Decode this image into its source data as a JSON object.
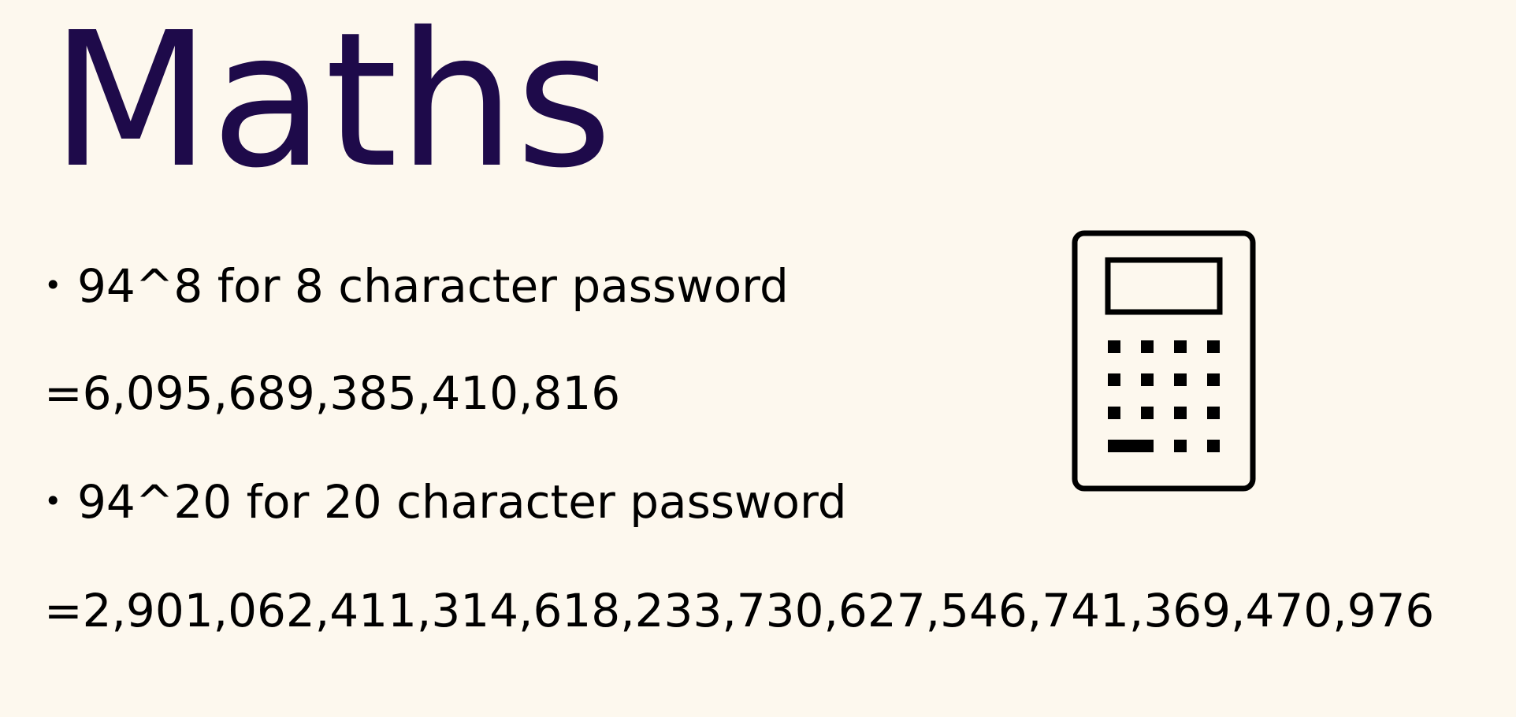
{
  "slide": {
    "title": "Maths",
    "items": [
      {
        "kind": "bullet",
        "text": "94^8 for 8 character password"
      },
      {
        "kind": "plain",
        "text": "=6,095,689,385,410,816"
      },
      {
        "kind": "bullet",
        "text": "94^20 for 20 character password"
      },
      {
        "kind": "plain",
        "text": "=2,901,062,411,314,618,233,730,627,546,741,369,470,976"
      }
    ],
    "icon": "calculator-icon"
  },
  "colors": {
    "background": "#fdf8ee",
    "title": "#1e0a4a",
    "text": "#000000"
  }
}
